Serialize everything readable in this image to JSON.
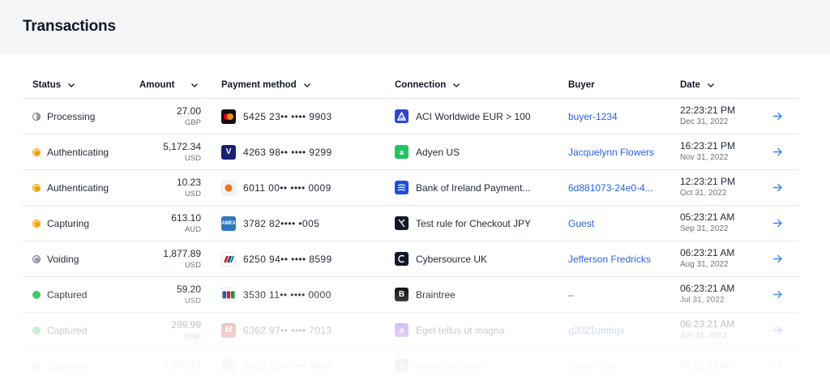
{
  "page": {
    "title": "Transactions"
  },
  "table": {
    "headers": {
      "status": "Status",
      "amount": "Amount",
      "payment": "Payment method",
      "connection": "Connection",
      "buyer": "Buyer",
      "date": "Date"
    },
    "rows": [
      {
        "status": "Processing",
        "status_kind": "processing",
        "amount": "27.00",
        "currency": "GBP",
        "card_icon": "mastercard-icon",
        "card": "5425 23•• •••• 9903",
        "conn_icon": "aci-icon",
        "connection": "ACI Worldwide EUR > 100",
        "buyer": "buyer-1234",
        "time": "22:23:21 PM",
        "date": "Dec 31, 2022"
      },
      {
        "status": "Authenticating",
        "status_kind": "auth",
        "amount": "5,172.34",
        "currency": "USD",
        "card_icon": "visa-icon",
        "card": "4263 98•• •••• 9299",
        "conn_icon": "adyen-icon",
        "connection": "Adyen US",
        "buyer": "Jacquelynn Flowers",
        "time": "16:23:21 PM",
        "date": "Nov 31, 2022"
      },
      {
        "status": "Authenticating",
        "status_kind": "auth",
        "amount": "10.23",
        "currency": "USD",
        "card_icon": "maestro-icon",
        "card": "6011 00•• •••• 0009",
        "conn_icon": "bank-of-ireland-icon",
        "connection": "Bank of Ireland Payment...",
        "buyer": "6d881073-24e0-4...",
        "time": "12:23:21 PM",
        "date": "Oct 31, 2022"
      },
      {
        "status": "Capturing",
        "status_kind": "auth",
        "amount": "613.10",
        "currency": "AUD",
        "card_icon": "amex-icon",
        "card": "3782 82•••• •005",
        "conn_icon": "checkout-icon",
        "connection": "Test rule for Checkout JPY",
        "buyer": "Guest",
        "time": "05:23:21 AM",
        "date": "Sep 31, 2022"
      },
      {
        "status": "Voiding",
        "status_kind": "voiding",
        "amount": "1,877.89",
        "currency": "USD",
        "card_icon": "unionpay-icon",
        "card": "6250 94•• •••• 8599",
        "conn_icon": "cybersource-icon",
        "connection": "Cybersource UK",
        "buyer": "Jefferson Fredricks",
        "time": "06:23:21 AM",
        "date": "Aug 31, 2022"
      },
      {
        "status": "Captured",
        "status_kind": "captured",
        "amount": "59.20",
        "currency": "USD",
        "card_icon": "jcb-icon",
        "card": "3530 11•• •••• 0000",
        "conn_icon": "braintree-icon",
        "connection": "Braintree",
        "buyer": "–",
        "time": "06:23:21 AM",
        "date": "Jul 31, 2022"
      },
      {
        "status": "Captured",
        "status_kind": "captured",
        "amount": "299.99",
        "currency": "USD",
        "card_icon": "hipercard-icon",
        "card": "6362 97•• •••• 7013",
        "conn_icon": "dlocal-icon",
        "connection": "Eget tellus ut magna",
        "buyer": "g2021umbqx",
        "time": "06:23:21 AM",
        "date": "Jun 31, 2022"
      },
      {
        "status": "Captured",
        "status_kind": "captured",
        "amount": "8,268.23",
        "currency": "",
        "card_icon": "card-icon",
        "card": "6062 82•• •••• 8634",
        "conn_icon": "dlocal-icon",
        "connection": "Fusce nec urna",
        "buyer": "buyer-1234",
        "time": "06:23:21 AM",
        "date": ""
      }
    ]
  },
  "colors": {
    "accent": "#2563eb",
    "captured": "#22c55e",
    "pending": "#f59e0b",
    "header_bg": "#f5f6f8"
  }
}
